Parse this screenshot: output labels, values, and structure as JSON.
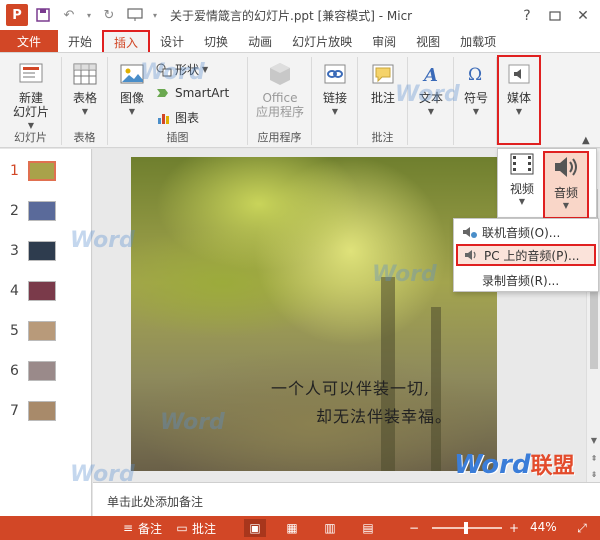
{
  "window": {
    "title": "关于爱情箴言的幻灯片.ppt [兼容模式] - Micr",
    "app_logo": "P"
  },
  "tabs": [
    "文件",
    "开始",
    "插入",
    "设计",
    "切换",
    "动画",
    "幻灯片放映",
    "审阅",
    "视图",
    "加载项"
  ],
  "ribbon": {
    "slides_group": {
      "label": "幻灯片",
      "new_slide": "新建\n幻灯片"
    },
    "tables_group": {
      "label": "表格",
      "table": "表格"
    },
    "images_group": {
      "label": "插图",
      "image": "图像",
      "shapes": "形状",
      "smartart": "SmartArt",
      "chart": "图表"
    },
    "apps_group": {
      "label": "应用程序",
      "office_apps": "Office\n应用程序"
    },
    "links_group": {
      "link": "链接"
    },
    "comments_group": {
      "label": "批注",
      "comment": "批注"
    },
    "text_group": {
      "text": "文本"
    },
    "symbols_group": {
      "symbol": "符号"
    },
    "media_group": {
      "media": "媒体"
    }
  },
  "media_popup": {
    "video": "视频",
    "audio": "音频"
  },
  "audio_menu": [
    {
      "label": "联机音频(O)..."
    },
    {
      "label": "PC 上的音频(P)..."
    },
    {
      "label": "录制音频(R)..."
    }
  ],
  "thumbnails": [
    {
      "num": "1",
      "color": "#a9a24a"
    },
    {
      "num": "2",
      "color": "#5a6a9a"
    },
    {
      "num": "3",
      "color": "#2e3c4e"
    },
    {
      "num": "4",
      "color": "#7a3a4a"
    },
    {
      "num": "5",
      "color": "#b89a7a"
    },
    {
      "num": "6",
      "color": "#9a8a8a"
    },
    {
      "num": "7",
      "color": "#a88a6a"
    }
  ],
  "slide": {
    "line1": "一个人可以伴装一切,",
    "line2": "却无法伴装幸福。"
  },
  "notes_placeholder": "单击此处添加备注",
  "status": {
    "notes": "备注",
    "comments": "批注",
    "zoom": "44%"
  },
  "watermark": {
    "word": "Word",
    "brand_cn": "联盟"
  },
  "colors": {
    "accent": "#d24726",
    "highlight": "#e02020"
  }
}
